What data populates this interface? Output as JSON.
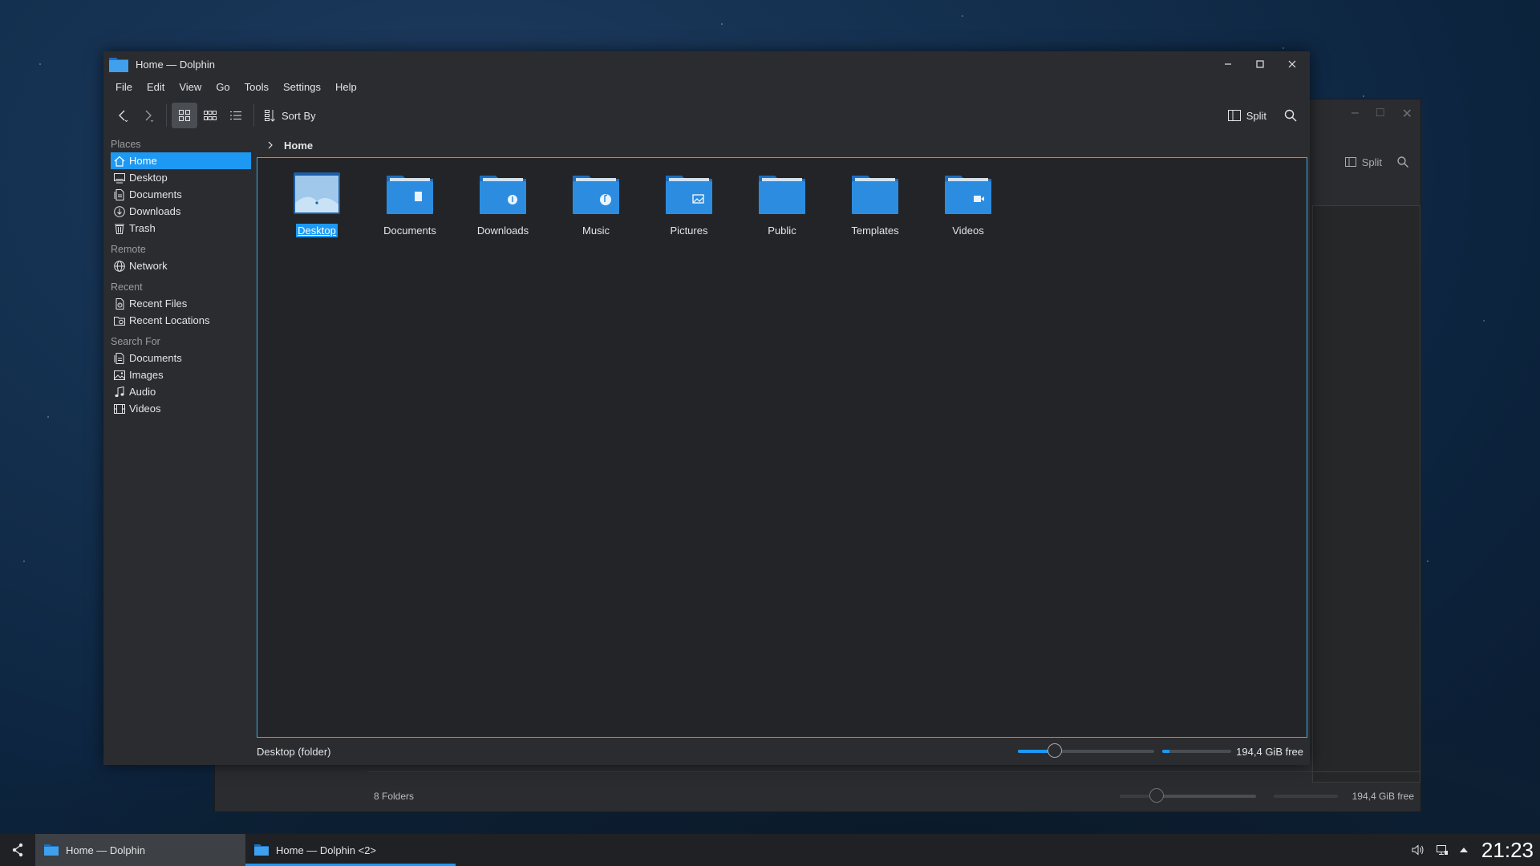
{
  "window": {
    "title": "Home — Dolphin",
    "controls": {
      "minimize": "minimize-icon",
      "maximize": "maximize-icon",
      "close": "close-icon"
    }
  },
  "menu": [
    "File",
    "Edit",
    "View",
    "Go",
    "Tools",
    "Settings",
    "Help"
  ],
  "toolbar": {
    "sort_label": "Sort By",
    "split_label": "Split",
    "view_modes": [
      "icons",
      "compact",
      "details"
    ],
    "active_view": "icons"
  },
  "places": {
    "groups": [
      {
        "title": "Places",
        "items": [
          {
            "label": "Home",
            "icon": "home-icon",
            "selected": true
          },
          {
            "label": "Desktop",
            "icon": "desktop-icon"
          },
          {
            "label": "Documents",
            "icon": "documents-icon"
          },
          {
            "label": "Downloads",
            "icon": "downloads-icon"
          },
          {
            "label": "Trash",
            "icon": "trash-icon"
          }
        ]
      },
      {
        "title": "Remote",
        "items": [
          {
            "label": "Network",
            "icon": "network-icon"
          }
        ]
      },
      {
        "title": "Recent",
        "items": [
          {
            "label": "Recent Files",
            "icon": "recent-files-icon"
          },
          {
            "label": "Recent Locations",
            "icon": "recent-locations-icon"
          }
        ]
      },
      {
        "title": "Search For",
        "items": [
          {
            "label": "Documents",
            "icon": "search-documents-icon"
          },
          {
            "label": "Images",
            "icon": "images-icon"
          },
          {
            "label": "Audio",
            "icon": "audio-icon"
          },
          {
            "label": "Videos",
            "icon": "videos-icon"
          }
        ]
      }
    ]
  },
  "breadcrumb": {
    "current": "Home"
  },
  "folders": [
    {
      "name": "Desktop",
      "emblem": "desktop",
      "selected": true
    },
    {
      "name": "Documents",
      "emblem": "document"
    },
    {
      "name": "Downloads",
      "emblem": "download"
    },
    {
      "name": "Music",
      "emblem": "music"
    },
    {
      "name": "Pictures",
      "emblem": "picture"
    },
    {
      "name": "Public",
      "emblem": "none"
    },
    {
      "name": "Templates",
      "emblem": "none"
    },
    {
      "name": "Videos",
      "emblem": "video"
    }
  ],
  "status": {
    "info": "Desktop (folder)",
    "zoom_fraction": 0.27,
    "space_used_fraction": 0.1,
    "free_space": "194,4 GiB free"
  },
  "back_window": {
    "split_label": "Split",
    "status_info": "8 Folders",
    "free_space": "194,4 GiB free"
  },
  "taskbar": {
    "tasks": [
      {
        "label": "Home — Dolphin",
        "active": true
      },
      {
        "label": "Home — Dolphin <2>",
        "active": false
      }
    ],
    "clock": "21:23"
  },
  "colors": {
    "accent": "#1d99f3",
    "window_bg": "#2a2c2f",
    "view_bg": "#232427",
    "folder": "#2c8ce0"
  }
}
